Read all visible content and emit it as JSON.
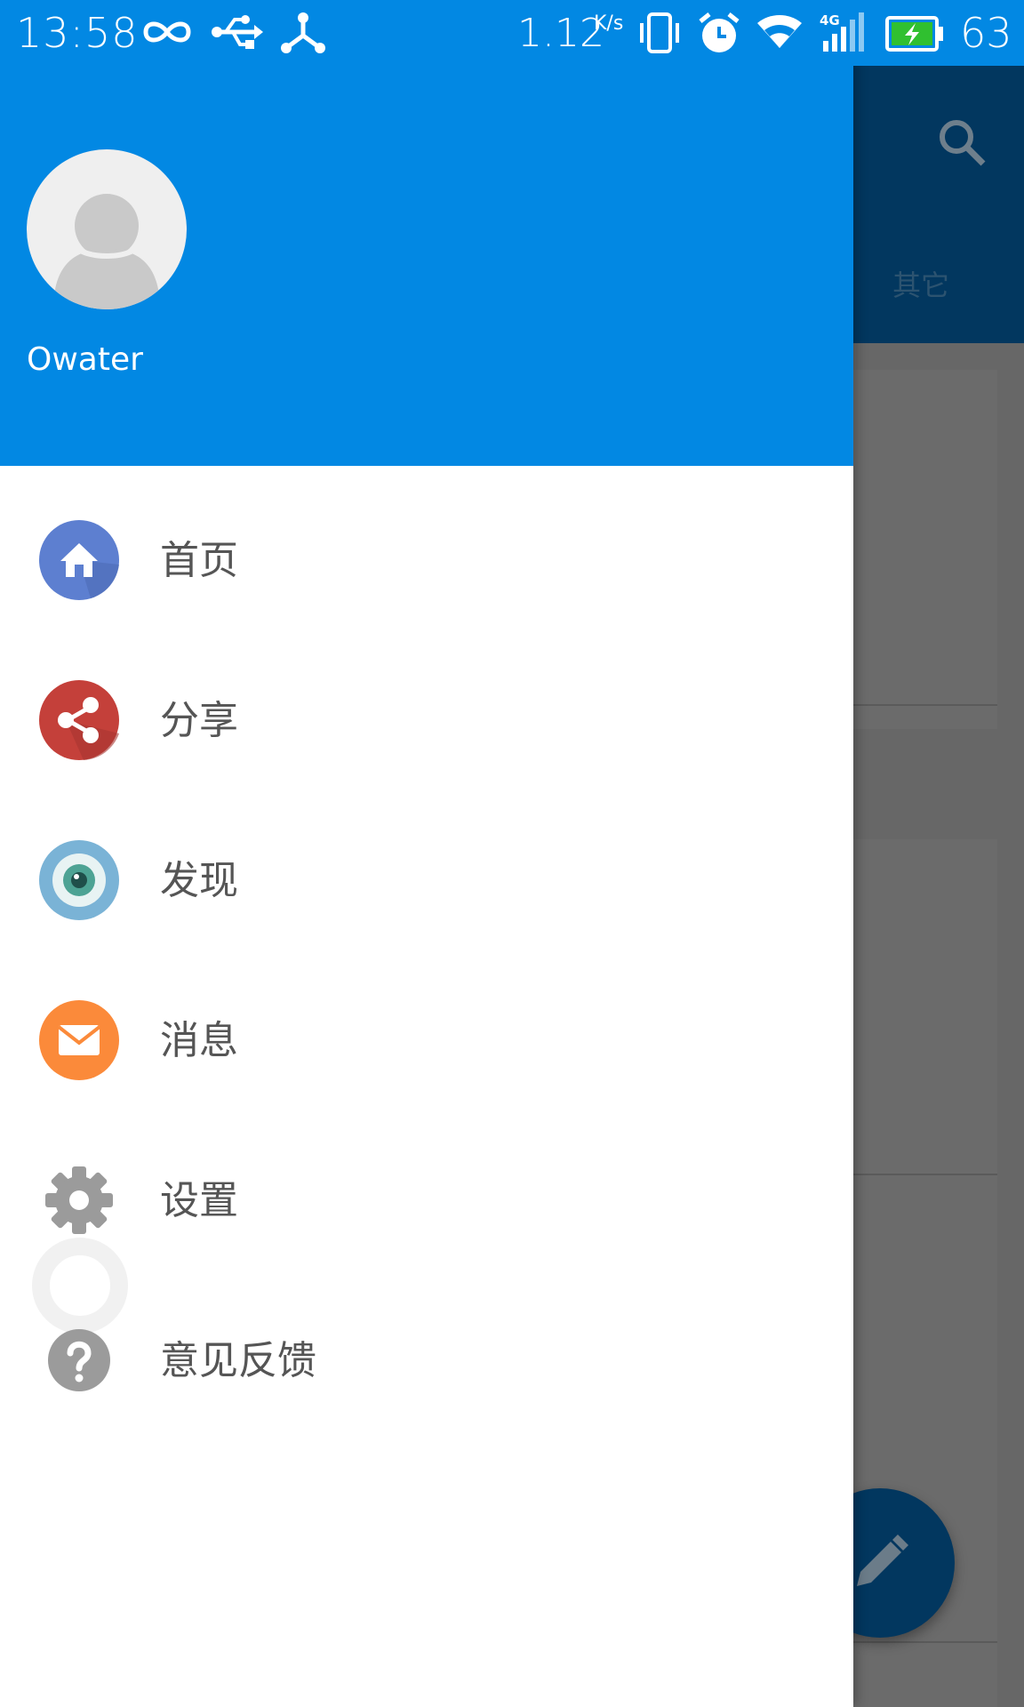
{
  "status_bar": {
    "time": "13:58",
    "speed": "1.12",
    "speed_unit": "K/s",
    "battery_percent": "63",
    "icons": [
      "infinity-icon",
      "usb-icon",
      "tether-icon",
      "vibrate-icon",
      "alarm-icon",
      "wifi-icon",
      "signal-4g-icon",
      "battery-charging-icon"
    ]
  },
  "drawer": {
    "username": "Owater",
    "items": [
      {
        "label": "首页",
        "icon": "home-icon",
        "color": "#5d7fd0"
      },
      {
        "label": "分享",
        "icon": "share-icon",
        "color": "#c4403a"
      },
      {
        "label": "发现",
        "icon": "eye-icon",
        "color": "#7ab3d6"
      },
      {
        "label": "消息",
        "icon": "mail-icon",
        "color": "#fb8a3a"
      },
      {
        "label": "设置",
        "icon": "gear-icon",
        "color": "#9b9b9b"
      },
      {
        "label": "意见反馈",
        "icon": "help-icon",
        "color": "#9b9b9b"
      }
    ]
  },
  "background_app": {
    "tab_label": "其它",
    "appbar_color": "#02375f"
  },
  "colors": {
    "primary": "#0288e3",
    "scrim": "#676767"
  }
}
